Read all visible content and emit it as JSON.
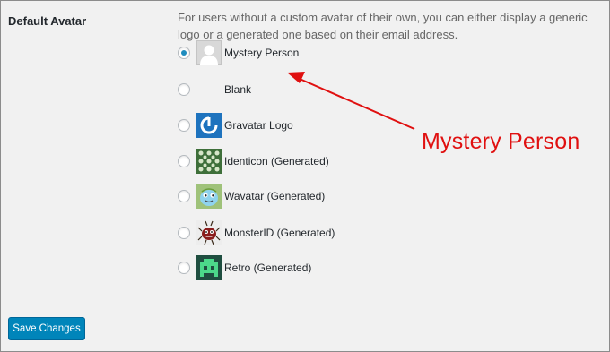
{
  "section": {
    "label": "Default Avatar",
    "description": "For users without a custom avatar of their own, you can either display a generic logo or a generated one based on their email address."
  },
  "options": [
    {
      "label": "Mystery Person",
      "icon": "mystery-person-icon",
      "selected": true
    },
    {
      "label": "Blank",
      "icon": "blank-icon",
      "selected": false
    },
    {
      "label": "Gravatar Logo",
      "icon": "gravatar-logo-icon",
      "selected": false
    },
    {
      "label": "Identicon (Generated)",
      "icon": "identicon-icon",
      "selected": false
    },
    {
      "label": "Wavatar (Generated)",
      "icon": "wavatar-icon",
      "selected": false
    },
    {
      "label": "MonsterID (Generated)",
      "icon": "monsterid-icon",
      "selected": false
    },
    {
      "label": "Retro (Generated)",
      "icon": "retro-icon",
      "selected": false
    }
  ],
  "buttons": {
    "save_label": "Save Changes"
  },
  "annotation": {
    "text": "Mystery Person",
    "color": "#e01010"
  },
  "colors": {
    "accent": "#0085ba",
    "background": "#f1f1f1"
  }
}
